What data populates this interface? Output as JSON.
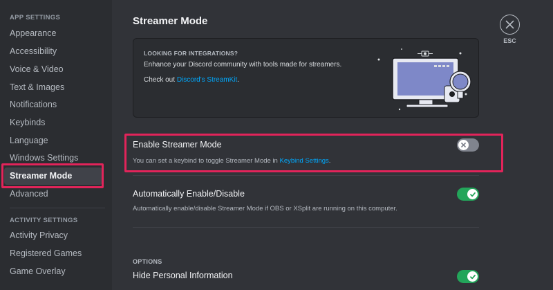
{
  "sidebar": {
    "app_settings_header": "APP SETTINGS",
    "items": [
      {
        "label": "Appearance"
      },
      {
        "label": "Accessibility"
      },
      {
        "label": "Voice & Video"
      },
      {
        "label": "Text & Images"
      },
      {
        "label": "Notifications"
      },
      {
        "label": "Keybinds"
      },
      {
        "label": "Language"
      },
      {
        "label": "Windows Settings"
      },
      {
        "label": "Streamer Mode",
        "selected": true
      },
      {
        "label": "Advanced"
      }
    ],
    "activity_settings_header": "ACTIVITY SETTINGS",
    "activity_items": [
      {
        "label": "Activity Privacy"
      },
      {
        "label": "Registered Games"
      },
      {
        "label": "Game Overlay"
      }
    ]
  },
  "page": {
    "title": "Streamer Mode",
    "esc_label": "ESC"
  },
  "promo": {
    "heading": "LOOKING FOR INTEGRATIONS?",
    "description": "Enhance your Discord community with tools made for streamers.",
    "check_out_text": "Check out",
    "link_text": "Discord's StreamKit",
    "link_suffix": "."
  },
  "settings": {
    "enable_streamer_mode": {
      "title": "Enable Streamer Mode",
      "desc_prefix": "You can set a keybind to toggle Streamer Mode in",
      "desc_link": "Keybind Settings",
      "desc_suffix": ".",
      "enabled": false
    },
    "auto_enable": {
      "title": "Automatically Enable/Disable",
      "desc": "Automatically enable/disable Streamer Mode if OBS or XSplit are running on this computer.",
      "enabled": true
    },
    "options_header": "OPTIONS",
    "hide_personal_info": {
      "title": "Hide Personal Information",
      "enabled": true
    }
  },
  "colors": {
    "highlight": "#e2245a",
    "toggle_on": "#23a55a",
    "toggle_off": "#80848e",
    "link": "#00a8fc"
  },
  "icons": {
    "close": "close-icon",
    "toggle_off": "x-icon",
    "toggle_on": "check-icon"
  }
}
